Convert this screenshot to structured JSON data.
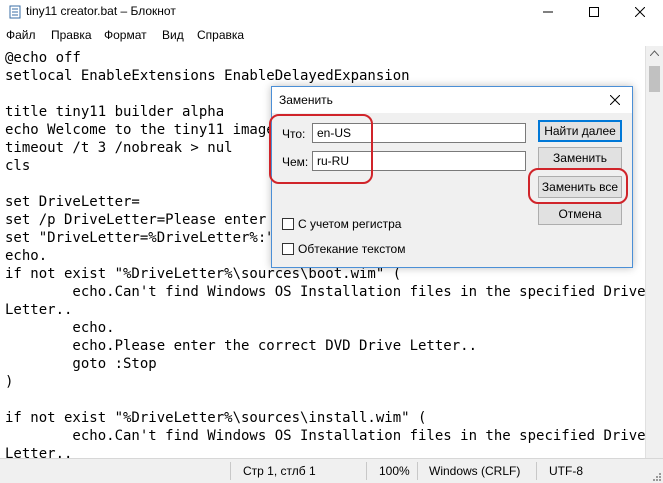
{
  "window": {
    "title": "tiny11 creator.bat – Блокнот"
  },
  "menu": [
    "Файл",
    "Правка",
    "Формат",
    "Вид",
    "Справка"
  ],
  "editor": {
    "lines": [
      "@echo off",
      "setlocal EnableExtensions EnableDelayedExpansion",
      "",
      "title tiny11 builder alpha",
      "echo Welcome to the tiny11 image",
      "timeout /t 3 /nobreak > nul",
      "cls",
      "",
      "set DriveLetter=",
      "set /p DriveLetter=Please enter th",
      "set \"DriveLetter=%DriveLetter%:\"",
      "echo.",
      "if not exist \"%DriveLetter%\\sources\\boot.wim\" (",
      "        echo.Can't find Windows OS Installation files in the specified Drive",
      "Letter..",
      "        echo.",
      "        echo.Please enter the correct DVD Drive Letter..",
      "        goto :Stop",
      ")",
      "",
      "if not exist \"%DriveLetter%\\sources\\install.wim\" (",
      "        echo.Can't find Windows OS Installation files in the specified Drive",
      "Letter.."
    ]
  },
  "status": {
    "position": "Стр 1, стлб 1",
    "zoom": "100%",
    "line_ending": "Windows (CRLF)",
    "encoding": "UTF-8"
  },
  "dialog": {
    "title": "Заменить",
    "find_label": "Что:",
    "find_value": "en-US",
    "replace_label": "Чем:",
    "replace_value": "ru-RU",
    "find_next": "Найти далее",
    "replace": "Заменить",
    "replace_all": "Заменить все",
    "cancel": "Отмена",
    "match_case": "С учетом регистра",
    "wrap_around": "Обтекание текстом"
  },
  "icons": {
    "app": "notepad-icon",
    "minimize": "minimize-icon",
    "maximize": "maximize-icon",
    "close": "close-icon"
  },
  "colors": {
    "annotation": "#d0242a",
    "accent": "#0078d7"
  }
}
